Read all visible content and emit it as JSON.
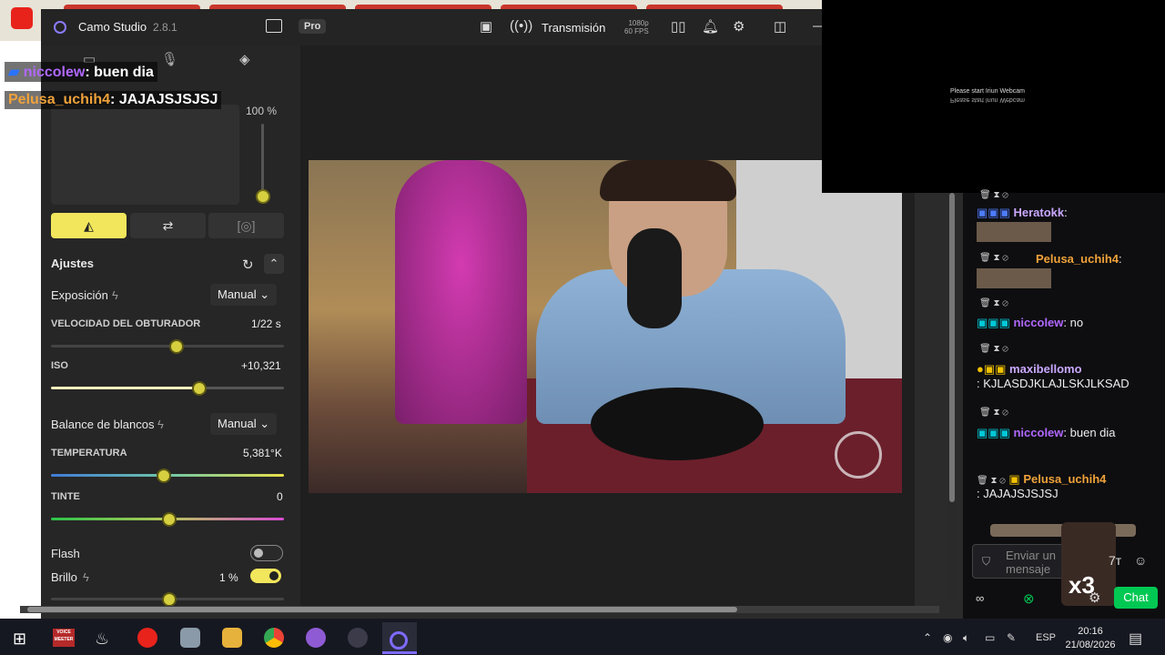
{
  "app": {
    "title": "Camo Studio",
    "version": "2.8.1",
    "pro_badge": "Pro",
    "stream_label": "Transmisión",
    "stream_resolution": "1080p",
    "stream_fps": "60 FPS"
  },
  "panel": {
    "zoom_value": "100 %",
    "zoom_level": 0.0,
    "section_title": "Ajustes",
    "exposure": {
      "label": "Exposición",
      "mode": "Manual"
    },
    "shutter": {
      "label": "VELOCIDAD DEL OBTURADOR",
      "value": "1/22 s",
      "level": 0.53
    },
    "iso": {
      "label": "ISO",
      "value": "+10,321",
      "level": 0.63
    },
    "white_balance": {
      "label": "Balance de blancos",
      "mode": "Manual"
    },
    "temperature": {
      "label": "TEMPERATURA",
      "value": "5,381°K",
      "level": 0.48
    },
    "tint": {
      "label": "TINTE",
      "value": "0",
      "level": 0.5
    },
    "flash": {
      "label": "Flash",
      "on": false
    },
    "brightness": {
      "label": "Brillo",
      "value": "1 %",
      "on": true,
      "level": 0.5
    }
  },
  "overlay_chat": [
    {
      "user": "niccolew",
      "text": ": buen dia",
      "color": "#b068ff"
    },
    {
      "user": "Pelusa_uchih4",
      "text": ": JAJAJSJSJSJ",
      "color": "#f0a23a"
    }
  ],
  "iriun": {
    "message": "Please start Iriun Webcam",
    "mirror": "Please start Iriun Webcam"
  },
  "chat": {
    "messages": [
      {
        "user": "Heratokk",
        "text": ":"
      },
      {
        "user": "Pelusa_uchih4",
        "text": ":"
      },
      {
        "user": "niccolew",
        "text": ": no"
      },
      {
        "user": "maxibellomo",
        "text": ": KJLASDJKLAJLSKJLKSAD"
      },
      {
        "user": "niccolew",
        "text": ": buen dia"
      },
      {
        "user": "Pelusa_uchih4",
        "text": ": JAJAJSJSJSJ"
      }
    ],
    "input_placeholder": "Enviar un mensaje",
    "chat_button": "Chat",
    "overlay_text": "x3"
  },
  "taskbar": {
    "time": "20:16",
    "date": "21/08/2026",
    "language": "ESP",
    "voice_meeter": "VOICE MEETER"
  },
  "colors": {
    "accent_yellow": "#d6cf3f",
    "twitch_green": "#00c853",
    "twitch_purple": "#b068ff",
    "twitch_orange": "#f0a23a"
  }
}
